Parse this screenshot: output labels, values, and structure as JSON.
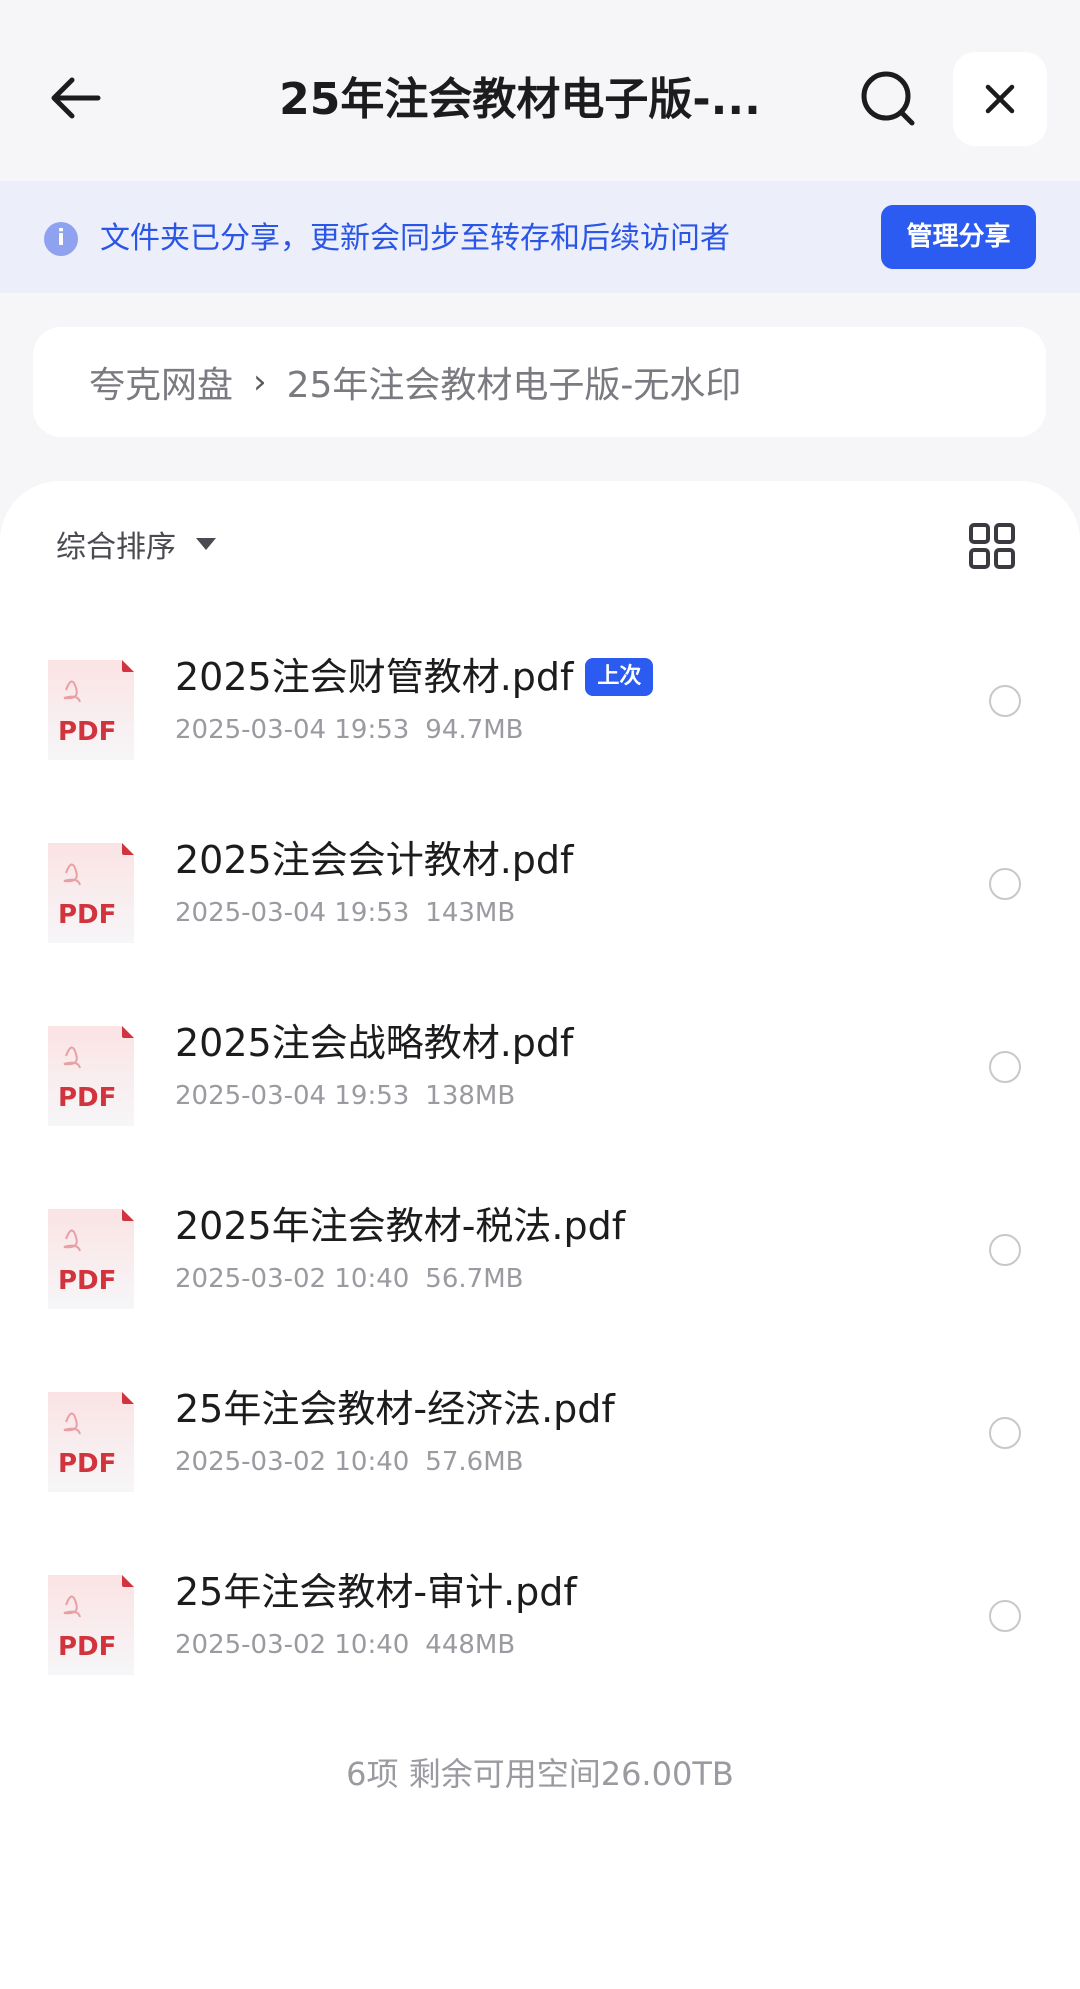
{
  "header": {
    "title": "25年注会教材电子版-...",
    "icons": {
      "back": "arrow-left-icon",
      "search": "search-icon",
      "close": "close-icon"
    }
  },
  "banner": {
    "message": "文件夹已分享，更新会同步至转存和后续访问者",
    "info_glyph": "i",
    "manage_label": "管理分享",
    "colors": {
      "background": "#eceefa",
      "text": "#2a56e8",
      "button": "#2b5bf0"
    }
  },
  "breadcrumb": {
    "items": [
      "夸克网盘",
      "25年注会教材电子版-无水印"
    ],
    "separator": "›"
  },
  "toolbar": {
    "sort_label": "综合排序",
    "view_toggle_icon": "grid-view-icon"
  },
  "files": [
    {
      "name": "2025注会财管教材.pdf",
      "date": "2025-03-04 19:53",
      "size": "94.7MB",
      "badge": "上次",
      "type_label": "PDF"
    },
    {
      "name": "2025注会会计教材.pdf",
      "date": "2025-03-04 19:53",
      "size": "143MB",
      "badge": "",
      "type_label": "PDF"
    },
    {
      "name": "2025注会战略教材.pdf",
      "date": "2025-03-04 19:53",
      "size": "138MB",
      "badge": "",
      "type_label": "PDF"
    },
    {
      "name": "2025年注会教材-税法.pdf",
      "date": "2025-03-02 10:40",
      "size": "56.7MB",
      "badge": "",
      "type_label": "PDF"
    },
    {
      "name": "25年注会教材-经济法.pdf",
      "date": "2025-03-02 10:40",
      "size": "57.6MB",
      "badge": "",
      "type_label": "PDF"
    },
    {
      "name": "25年注会教材-审计.pdf",
      "date": "2025-03-02 10:40",
      "size": "448MB",
      "badge": "",
      "type_label": "PDF"
    }
  ],
  "footer": {
    "summary": "6项 剩余可用空间26.00TB"
  },
  "colors": {
    "accent": "#2b5bf0",
    "pdf_red": "#d2343e",
    "page_bg": "#f6f6f8"
  }
}
